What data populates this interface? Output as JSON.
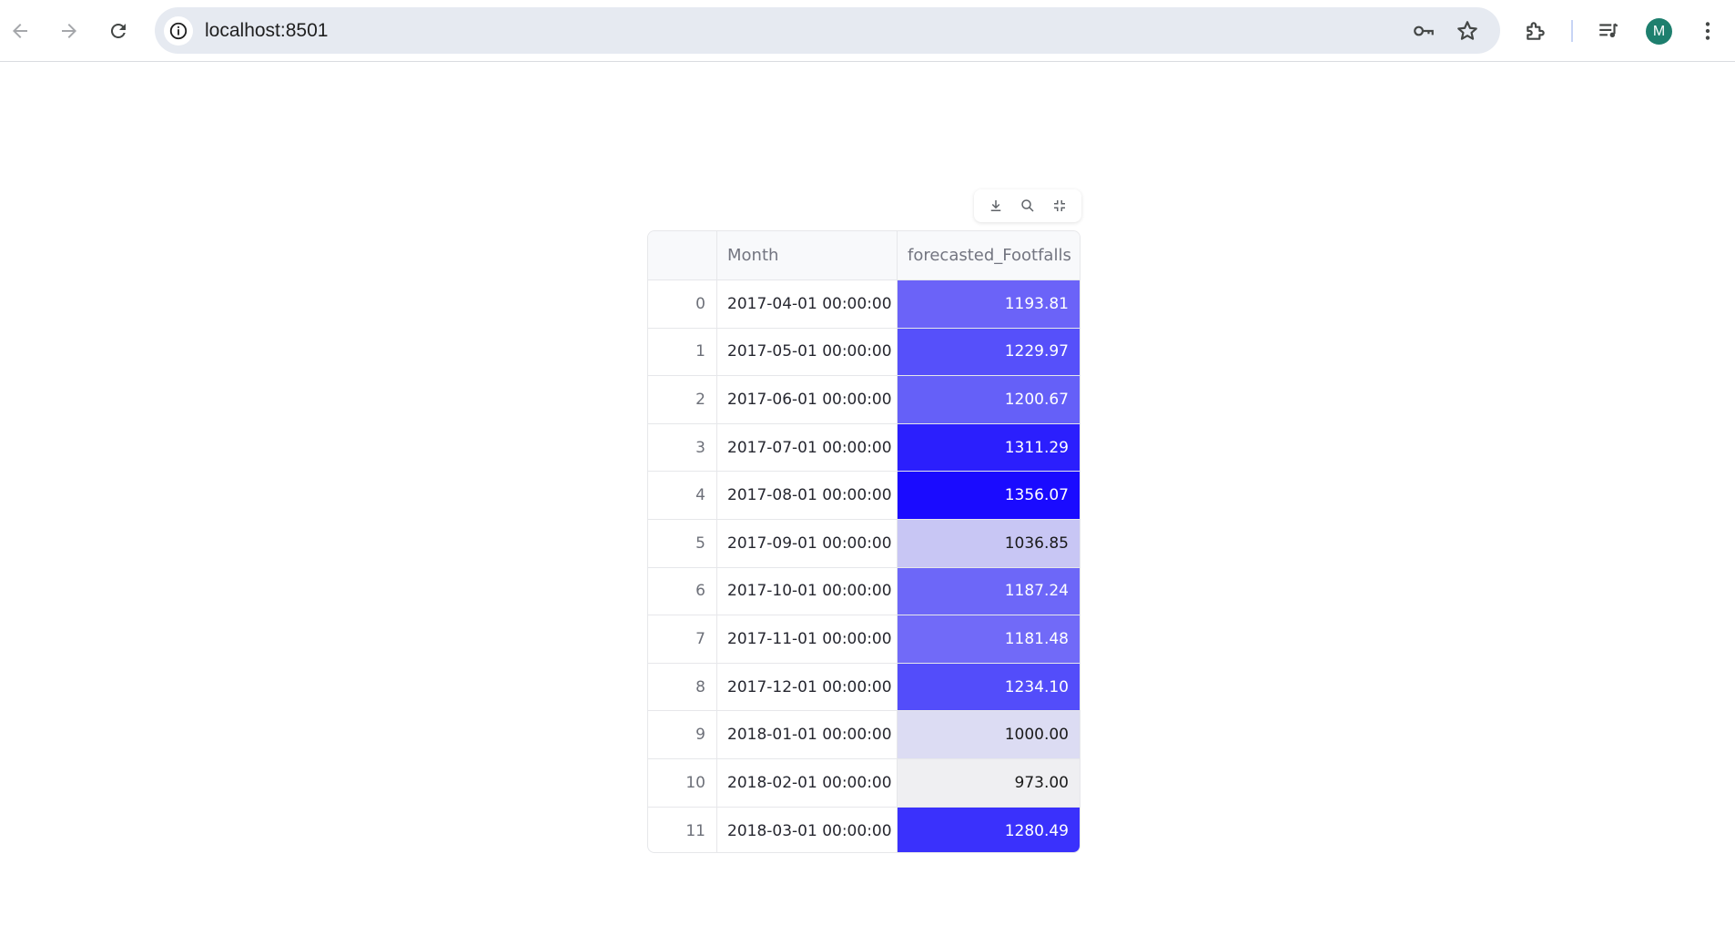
{
  "browser": {
    "url": "localhost:8501",
    "profile_initial": "M",
    "icons": {
      "back": "arrow-left-icon",
      "forward": "arrow-right-icon",
      "reload": "reload-icon",
      "site_info": "info-icon",
      "password": "key-icon",
      "bookmark": "star-icon",
      "extensions": "puzzle-icon",
      "media": "media-control-icon",
      "menu": "kebab-menu-icon"
    }
  },
  "dataframe": {
    "toolbar_icons": [
      "download-icon",
      "search-icon",
      "fullscreen-exit-icon"
    ],
    "columns": [
      "",
      "Month",
      "forecasted_Footfalls"
    ],
    "rows": [
      {
        "index": "0",
        "month": "2017-04-01 00:00:00",
        "value": "1193.81",
        "bg": "#6b63f8",
        "fg": "#ffffff"
      },
      {
        "index": "1",
        "month": "2017-05-01 00:00:00",
        "value": "1229.97",
        "bg": "#5650fa",
        "fg": "#ffffff"
      },
      {
        "index": "2",
        "month": "2017-06-01 00:00:00",
        "value": "1200.67",
        "bg": "#6560f8",
        "fg": "#ffffff"
      },
      {
        "index": "3",
        "month": "2017-07-01 00:00:00",
        "value": "1311.29",
        "bg": "#2b1ffd",
        "fg": "#ffffff"
      },
      {
        "index": "4",
        "month": "2017-08-01 00:00:00",
        "value": "1356.07",
        "bg": "#1a0bff",
        "fg": "#ffffff"
      },
      {
        "index": "5",
        "month": "2017-09-01 00:00:00",
        "value": "1036.85",
        "bg": "#c8c6f4",
        "fg": "#1a1a1a"
      },
      {
        "index": "6",
        "month": "2017-10-01 00:00:00",
        "value": "1187.24",
        "bg": "#6d67f8",
        "fg": "#ffffff"
      },
      {
        "index": "7",
        "month": "2017-11-01 00:00:00",
        "value": "1181.48",
        "bg": "#716af8",
        "fg": "#ffffff"
      },
      {
        "index": "8",
        "month": "2017-12-01 00:00:00",
        "value": "1234.10",
        "bg": "#534dfa",
        "fg": "#ffffff"
      },
      {
        "index": "9",
        "month": "2018-01-01 00:00:00",
        "value": "1000.00",
        "bg": "#dcdcf3",
        "fg": "#1a1a1a"
      },
      {
        "index": "10",
        "month": "2018-02-01 00:00:00",
        "value": "973.00",
        "bg": "#efeff2",
        "fg": "#1a1a1a"
      },
      {
        "index": "11",
        "month": "2018-03-01 00:00:00",
        "value": "1280.49",
        "bg": "#3a31fc",
        "fg": "#ffffff"
      }
    ]
  }
}
